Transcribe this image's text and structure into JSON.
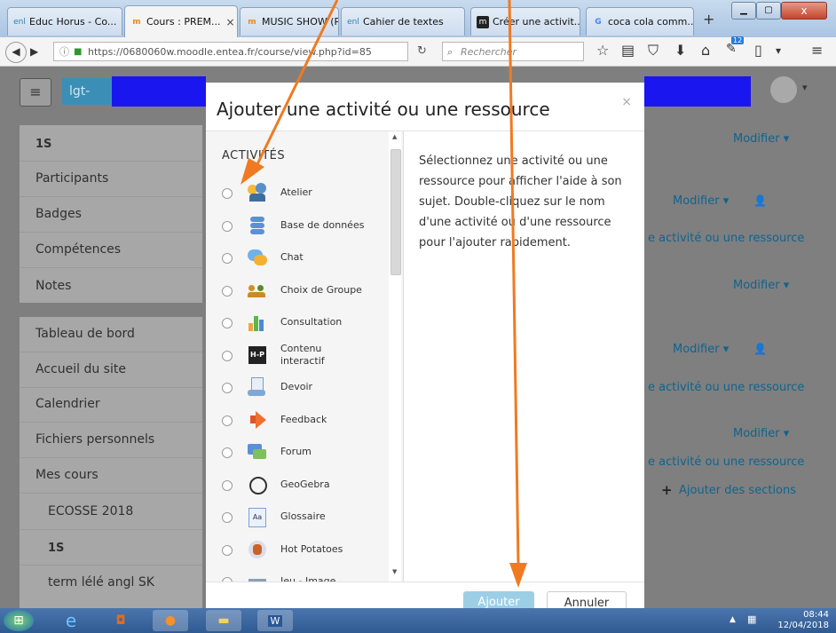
{
  "browser": {
    "tabs": [
      {
        "icon_text": "enl",
        "label": "Educ Horus - Co..."
      },
      {
        "icon_text": "m",
        "label": "Cours : PREM...",
        "active": true
      },
      {
        "icon_text": "m",
        "label": "MUSIC SHOW (P..."
      },
      {
        "icon_text": "enl",
        "label": "Cahier de textes"
      },
      {
        "icon_text": "m",
        "label": "Créer une activit..."
      },
      {
        "icon_text": "G",
        "label": "coca cola comm..."
      }
    ],
    "new_tab_label": "+",
    "url": "https://0680060w.moodle.entea.fr/course/view.php?id=85",
    "search_placeholder": "Rechercher",
    "notification_count": "12"
  },
  "page": {
    "site_button": "lgt-",
    "sidebar_top": [
      "1S",
      "Participants",
      "Badges",
      "Compétences",
      "Notes"
    ],
    "sidebar_bottom": [
      "Tableau de bord",
      "Accueil du site",
      "Calendrier",
      "Fichiers personnels",
      "Mes cours",
      "ECOSSE 2018",
      "1S",
      "term lélé angl SK"
    ],
    "right": {
      "edit": "Modifier ▾",
      "add_activity": "e activité ou une ressource",
      "add_sections": "Ajouter des sections"
    }
  },
  "modal": {
    "title": "Ajouter une activité ou une ressource",
    "close": "×",
    "list_heading": "ACTIVITÉS",
    "activities": [
      {
        "label": "Atelier",
        "icon": "workshop-icon"
      },
      {
        "label": "Base de données",
        "icon": "database-icon"
      },
      {
        "label": "Chat",
        "icon": "chat-icon"
      },
      {
        "label": "Choix de Groupe",
        "icon": "group-choice-icon"
      },
      {
        "label": "Consultation",
        "icon": "chart-icon"
      },
      {
        "label": "Contenu interactif",
        "icon": "h5p-icon"
      },
      {
        "label": "Devoir",
        "icon": "assignment-icon"
      },
      {
        "label": "Feedback",
        "icon": "megaphone-icon"
      },
      {
        "label": "Forum",
        "icon": "forum-icon"
      },
      {
        "label": "GeoGebra",
        "icon": "geogebra-icon"
      },
      {
        "label": "Glossaire",
        "icon": "glossary-icon"
      },
      {
        "label": "Hot Potatoes",
        "icon": "hotpot-icon"
      },
      {
        "label": "Jeu - Image",
        "icon": "game-icon"
      }
    ],
    "help_text": "Sélectionnez une activité ou une ressource pour afficher l'aide à son sujet. Double-cliquez sur le nom d'une activité ou d'une ressource pour l'ajouter rapidement.",
    "add_button": "Ajouter",
    "cancel_button": "Annuler"
  },
  "taskbar": {
    "time": "08:44",
    "date": "12/04/2018"
  },
  "colors": {
    "accent": "#10648d",
    "redaction": "#1a16f0",
    "arrow": "#f07a22"
  }
}
